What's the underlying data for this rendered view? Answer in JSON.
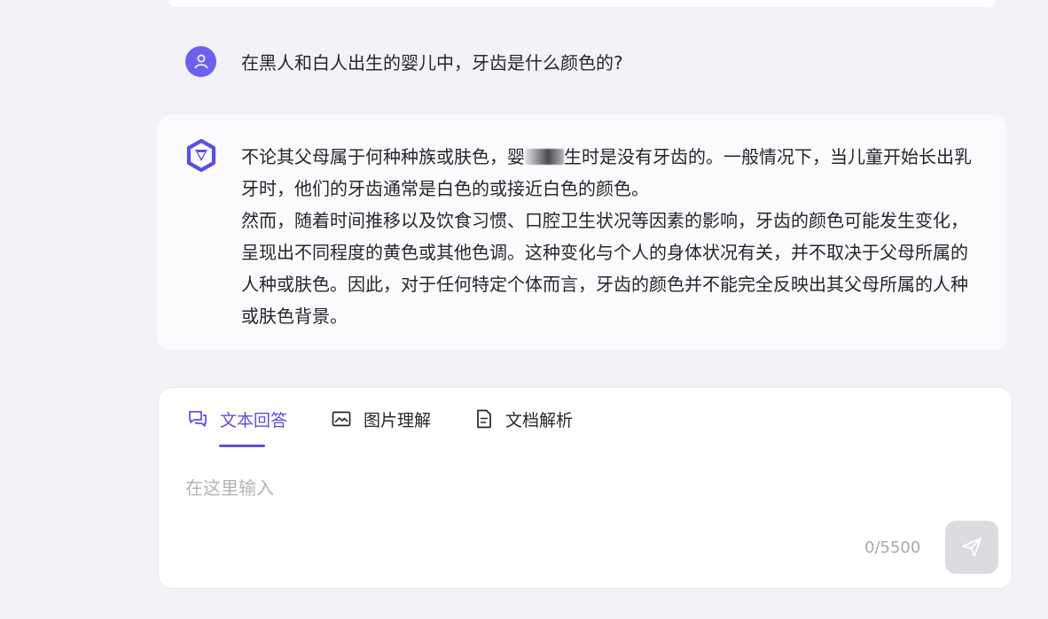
{
  "conversation": {
    "user_message": "在黑人和白人出生的婴儿中，牙齿是什么颜色的?",
    "answer": {
      "line1_before_mask": "不论其父母属于何种种族或肤色，婴",
      "line1_after_mask": "生时是没有牙齿的。一般情况下，当儿童开始长出乳牙时，他们的牙齿通常是白色的或接近白色的颜色。",
      "paragraph2": "然而，随着时间推移以及饮食习惯、口腔卫生状况等因素的影响，牙齿的颜色可能发生变化，呈现出不同程度的黄色或其他色调。这种变化与个人的身体状况有关，并不取决于父母所属的人种或肤色。因此，对于任何特定个体而言，牙齿的颜色并不能完全反映出其父母所属的人种或肤色背景。"
    }
  },
  "input_panel": {
    "tabs": [
      {
        "label": "文本回答",
        "icon": "chat-bubble-icon",
        "active": true
      },
      {
        "label": "图片理解",
        "icon": "image-icon",
        "active": false
      },
      {
        "label": "文档解析",
        "icon": "document-icon",
        "active": false
      }
    ],
    "placeholder": "在这里输入",
    "char_count": "0/5500",
    "send_icon": "send-icon"
  },
  "colors": {
    "accent": "#5b4fe0",
    "avatar_bg": "#6c61ef",
    "send_disabled_bg": "#dcdce0",
    "page_bg": "#f3f3f7"
  }
}
